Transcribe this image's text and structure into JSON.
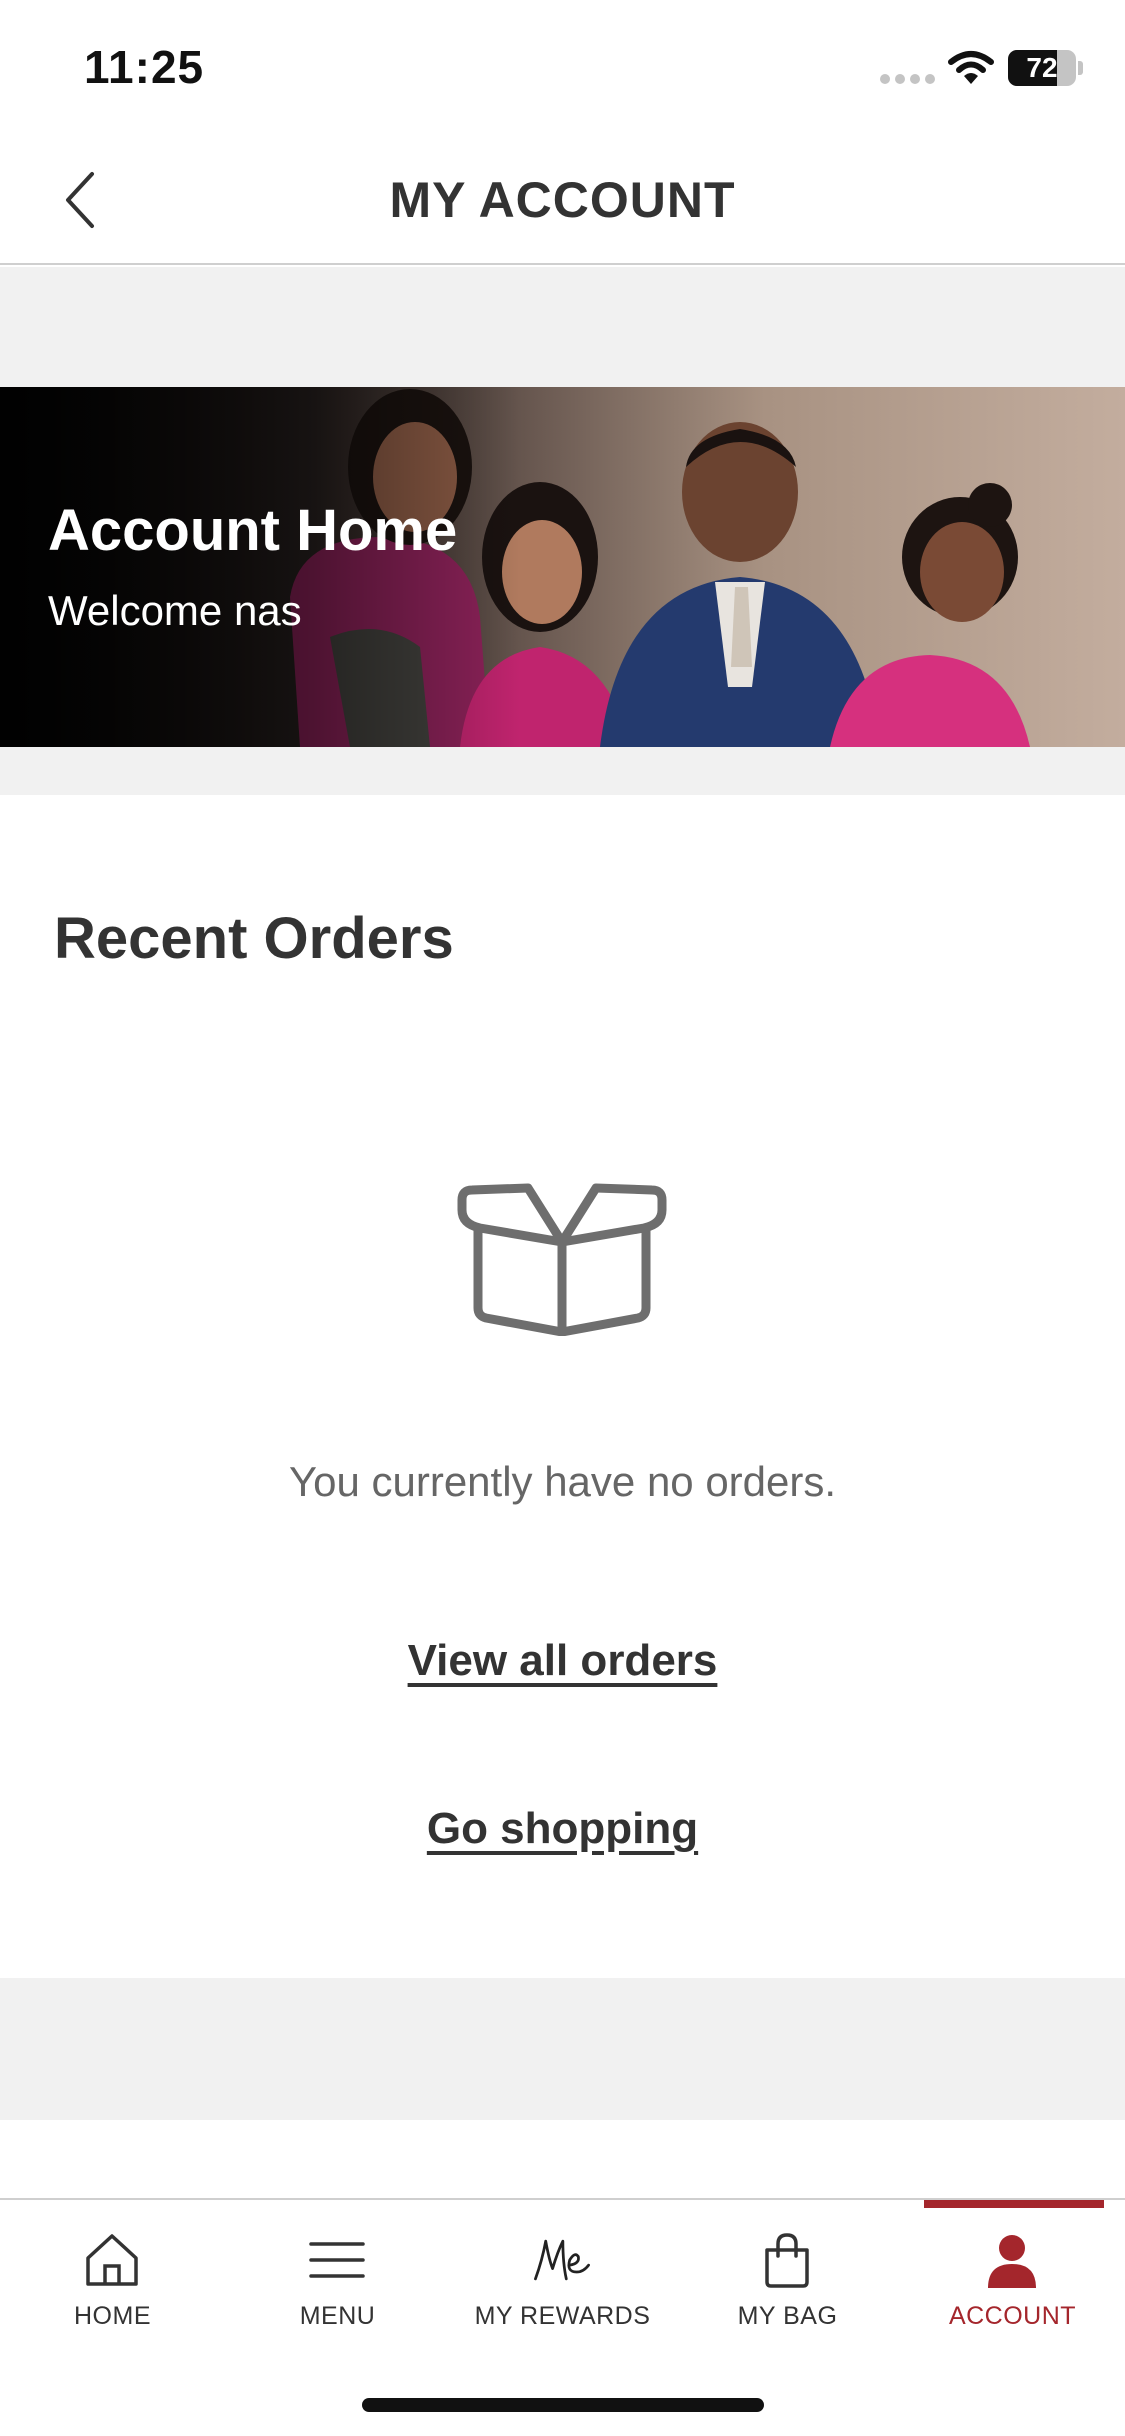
{
  "status_bar": {
    "time": "11:25",
    "battery": "72",
    "battery_level_percent": 72
  },
  "header": {
    "title": "MY ACCOUNT"
  },
  "hero": {
    "title": "Account Home",
    "subtitle": "Welcome nas"
  },
  "orders": {
    "title": "Recent Orders",
    "empty_message": "You currently have no orders.",
    "view_all_label": "View all orders",
    "go_shopping_label": "Go shopping"
  },
  "tabbar": {
    "items": [
      {
        "label": "HOME",
        "icon": "home-icon"
      },
      {
        "label": "MENU",
        "icon": "menu-icon"
      },
      {
        "label": "MY REWARDS",
        "icon": "me-rewards-icon"
      },
      {
        "label": "MY BAG",
        "icon": "shopping-bag-icon"
      },
      {
        "label": "ACCOUNT",
        "icon": "person-icon",
        "active": true
      }
    ]
  },
  "colors": {
    "accent": "#a4262c",
    "text": "#333333",
    "band": "#f1f1f1"
  }
}
